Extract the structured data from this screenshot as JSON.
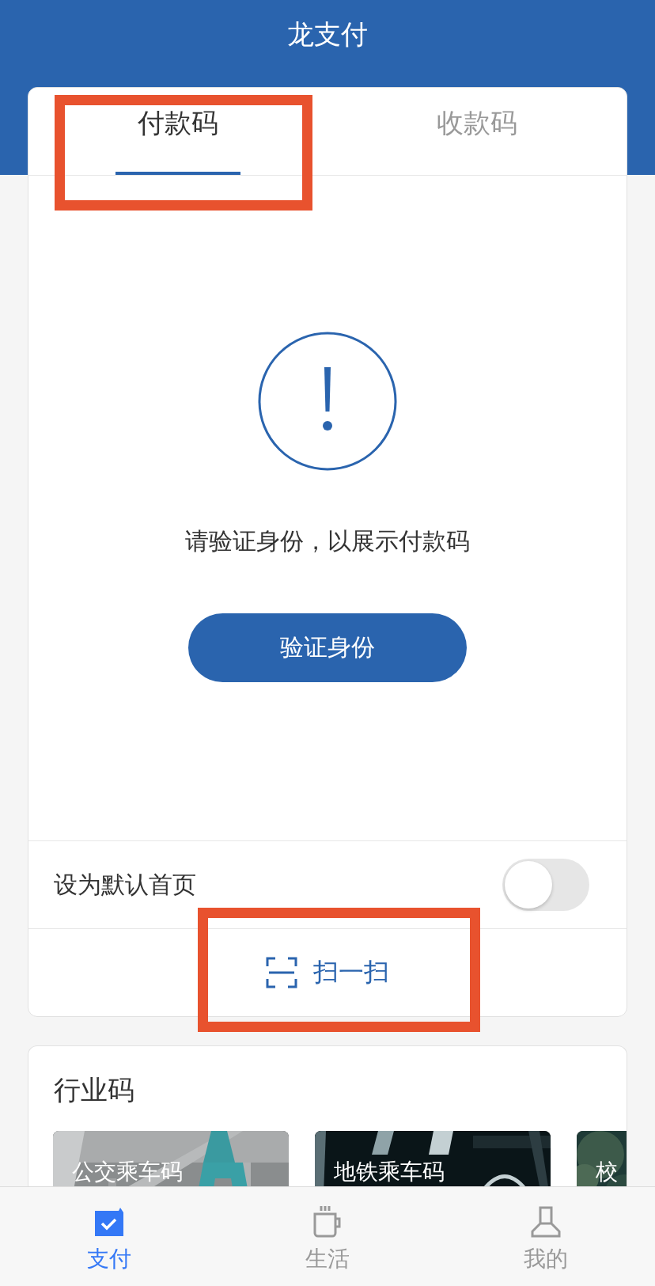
{
  "header": {
    "title": "龙支付"
  },
  "code_tabs": [
    {
      "label": "付款码",
      "selected": true,
      "highlighted": true
    },
    {
      "label": "收款码",
      "selected": false,
      "highlighted": false
    }
  ],
  "notice": {
    "message": "请验证身份，以展示付款码",
    "button": "验证身份"
  },
  "default_home": {
    "label": "设为默认首页",
    "on": false
  },
  "scan": {
    "label": "扫一扫",
    "highlighted": true
  },
  "industry": {
    "title": "行业码",
    "tiles": [
      {
        "label": "公交乘车码",
        "kind": "picture"
      },
      {
        "label": "地铁乘车码",
        "kind": "picture"
      },
      {
        "label": "校",
        "kind": "picture"
      }
    ]
  },
  "bottom_tabs": [
    {
      "label": "支付",
      "selected": true
    },
    {
      "label": "生活",
      "selected": false
    },
    {
      "label": "我的",
      "selected": false
    }
  ]
}
